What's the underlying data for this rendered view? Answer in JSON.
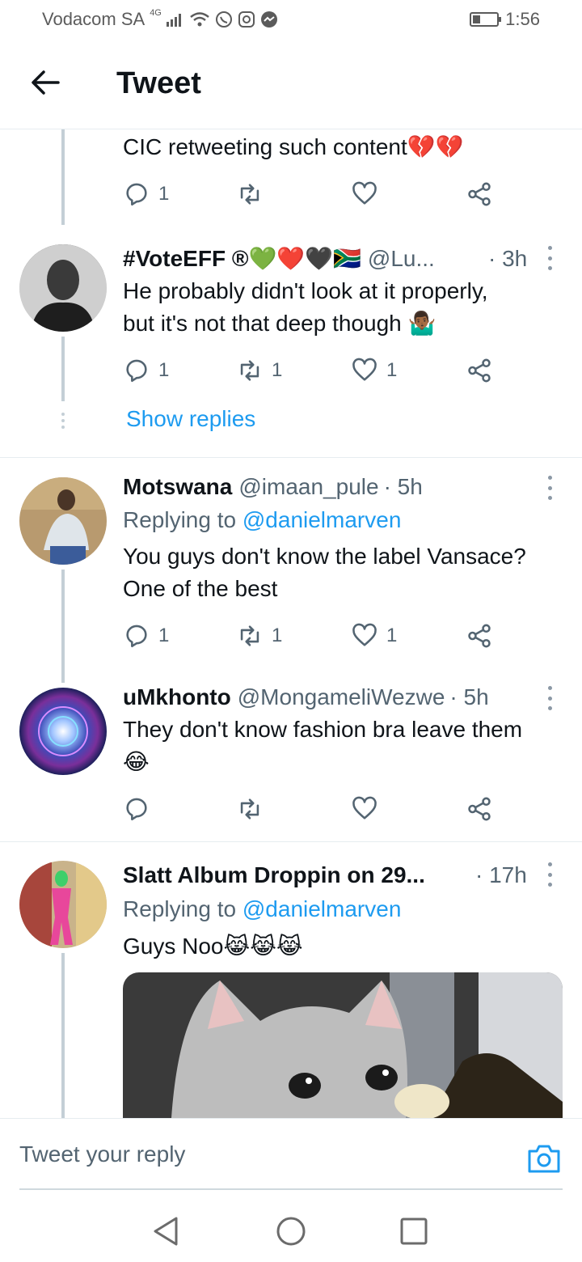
{
  "status_bar": {
    "carrier": "Vodacom SA",
    "network": "4G",
    "time": "1:56",
    "battery_level": 0.25
  },
  "header": {
    "title": "Tweet",
    "back_icon": "arrow-left-icon"
  },
  "tweets": [
    {
      "text": "CIC retweeting such content💔💔",
      "replies": "1",
      "retweets": "",
      "likes": ""
    },
    {
      "name": "#VoteEFF ®💚❤️🖤🇿🇦",
      "handle": "@Lu...",
      "time": "· 3h",
      "text_line1": "He probably didn't look at it properly,",
      "text_line2": "but it's not that deep though 🤷🏾‍♂️",
      "replies": "1",
      "retweets": "1",
      "likes": "1",
      "show_replies": "Show replies"
    },
    {
      "name": "Motswana",
      "handle": "@imaan_pule",
      "time": "· 5h",
      "replying_prefix": "Replying to",
      "replying_to": "@danielmarven",
      "text_line1": "You guys don't know the label Vansace?",
      "text_line2": "One of the best",
      "replies": "1",
      "retweets": "1",
      "likes": "1"
    },
    {
      "name": "uMkhonto",
      "handle": "@MongameliWezwe",
      "time": "· 5h",
      "text_line1": "They don't know fashion bra leave them",
      "text_line2": "😂",
      "replies": "",
      "retweets": "",
      "likes": ""
    },
    {
      "name": "Slatt Album Droppin on 29...",
      "handle": "",
      "time": "· 17h",
      "replying_prefix": "Replying to",
      "replying_to": "@danielmarven",
      "text_line1": "Guys Noo😹😹😹"
    }
  ],
  "reply_bar": {
    "placeholder": "Tweet your reply",
    "camera_icon": "camera-icon"
  },
  "nav_bar": {
    "back": "triangle-back-icon",
    "home": "circle-home-icon",
    "recents": "square-recents-icon"
  },
  "colors": {
    "accent": "#1d9bf0",
    "secondary_text": "#536471",
    "thread_line": "#c4cfd6"
  }
}
